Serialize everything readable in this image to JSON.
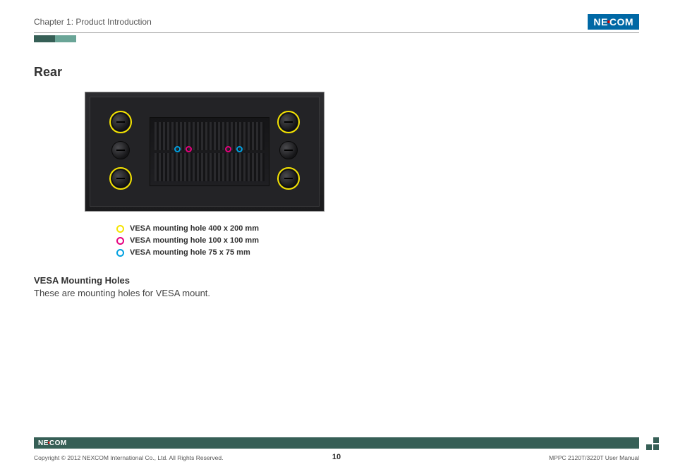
{
  "header": {
    "chapter": "Chapter 1: Product Introduction"
  },
  "section": {
    "title": "Rear"
  },
  "legend": {
    "items": [
      {
        "label": "VESA mounting hole 400 x 200 mm"
      },
      {
        "label": "VESA mounting hole 100 x 100 mm"
      },
      {
        "label": "VESA mounting hole 75 x 75 mm"
      }
    ]
  },
  "subsection": {
    "heading": "VESA Mounting Holes",
    "body": "These are mounting holes for VESA mount."
  },
  "footer": {
    "copyright": "Copyright © 2012 NEXCOM International Co., Ltd. All Rights Reserved.",
    "doc": "MPPC 2120T/3220T User Manual",
    "page": "10"
  },
  "brand": {
    "name": "NEXCOM"
  }
}
